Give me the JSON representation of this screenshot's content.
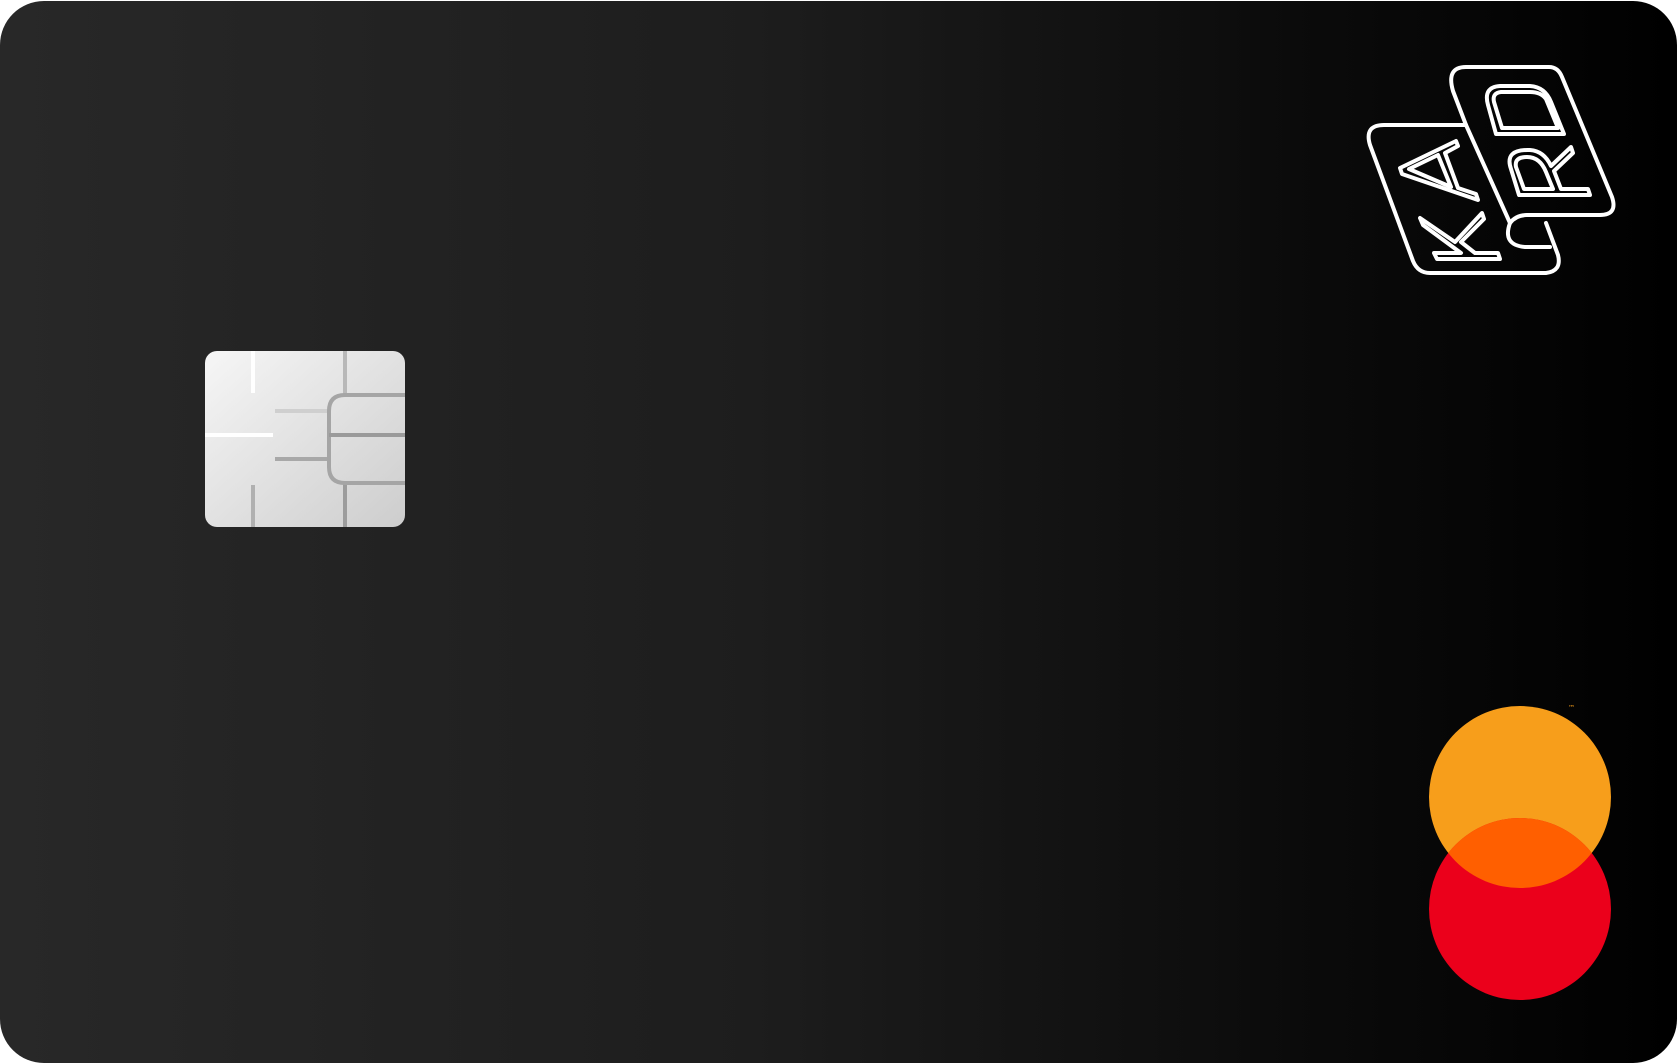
{
  "card": {
    "brand": {
      "name": "KARD",
      "logo_icon": "kard-wordmark-icon",
      "stroke_color": "#ffffff"
    },
    "chip": {
      "icon": "emv-chip-icon",
      "color_light": "#f4f4f4",
      "color_dark": "#d0d0d0"
    },
    "network": {
      "name": "Mastercard",
      "icon": "mastercard-logo-icon",
      "tm_symbol": "™",
      "colors": {
        "top_circle": "#f79e1b",
        "bottom_circle": "#eb001b",
        "overlap": "#ff5f00"
      }
    },
    "background": {
      "gradient_start": "#282828",
      "gradient_end": "#000000"
    }
  }
}
